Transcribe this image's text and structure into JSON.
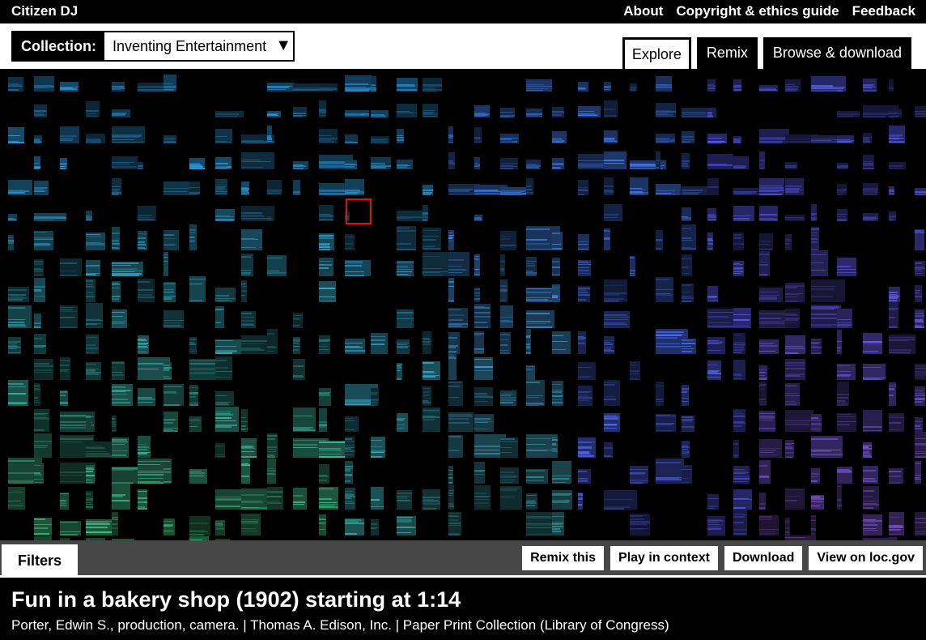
{
  "app": {
    "brand": "Citizen DJ",
    "nav": [
      {
        "label": "About"
      },
      {
        "label": "Copyright & ethics guide"
      },
      {
        "label": "Feedback"
      }
    ]
  },
  "collection": {
    "label": "Collection:",
    "selected": "Inventing Entertainment",
    "caret": "▼"
  },
  "tabs": [
    {
      "label": "Explore",
      "active": true
    },
    {
      "label": "Remix",
      "active": false
    },
    {
      "label": "Browse & download",
      "active": false
    }
  ],
  "grid": {
    "description": "spectrogram sample grid",
    "palette": {
      "cyan": "#2a8ccc",
      "teal": "#3aa39a",
      "green": "#3fae6a",
      "blue": "#3a6fd8",
      "indigo": "#4b4fd0",
      "violet": "#7a4fc0",
      "selection": "#e01010"
    }
  },
  "filters": {
    "label": "Filters"
  },
  "actions": [
    {
      "label": "Remix this"
    },
    {
      "label": "Play in context"
    },
    {
      "label": "Download"
    },
    {
      "label": "View on loc.gov"
    }
  ],
  "selected_clip": {
    "title": "Fun in a bakery shop (1902) starting at 1:14",
    "meta": "Porter, Edwin S., production, camera. | Thomas A. Edison, Inc. | Paper Print Collection (Library of Congress)"
  }
}
